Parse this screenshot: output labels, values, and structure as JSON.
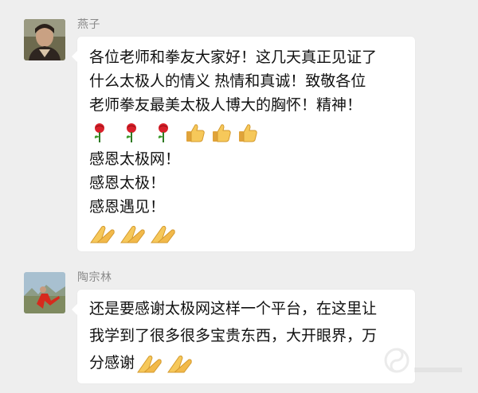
{
  "messages": [
    {
      "sender": "燕子",
      "lines": [
        "各位老师和拳友大家好！这几天真正见证了",
        "什么太极人的情义 热情和真诚！致敬各位",
        "老师拳友最美太极人博大的胸怀！精神！"
      ],
      "emoji_row": [
        "rose-icon",
        "rose-icon",
        "rose-icon",
        "thumbs-up-icon",
        "thumbs-up-icon",
        "thumbs-up-icon"
      ],
      "lines_after": [
        "感恩太极网！",
        "感恩太极！",
        "感恩遇见！"
      ],
      "emoji_row2": [
        "pray-icon",
        "pray-icon",
        "pray-icon"
      ]
    },
    {
      "sender": "陶宗林",
      "lines": [
        "还是要感谢太极网这样一个平台，在这里让",
        "我学到了很多很多宝贵东西，大开眼界，万"
      ],
      "last_line": "分感谢",
      "last_line_emoji": [
        "pray-icon",
        "pray-icon"
      ]
    }
  ],
  "colors": {
    "background": "#eeeeee",
    "bubble": "#ffffff",
    "sender_name": "#8a8a8a",
    "text": "#111111"
  }
}
